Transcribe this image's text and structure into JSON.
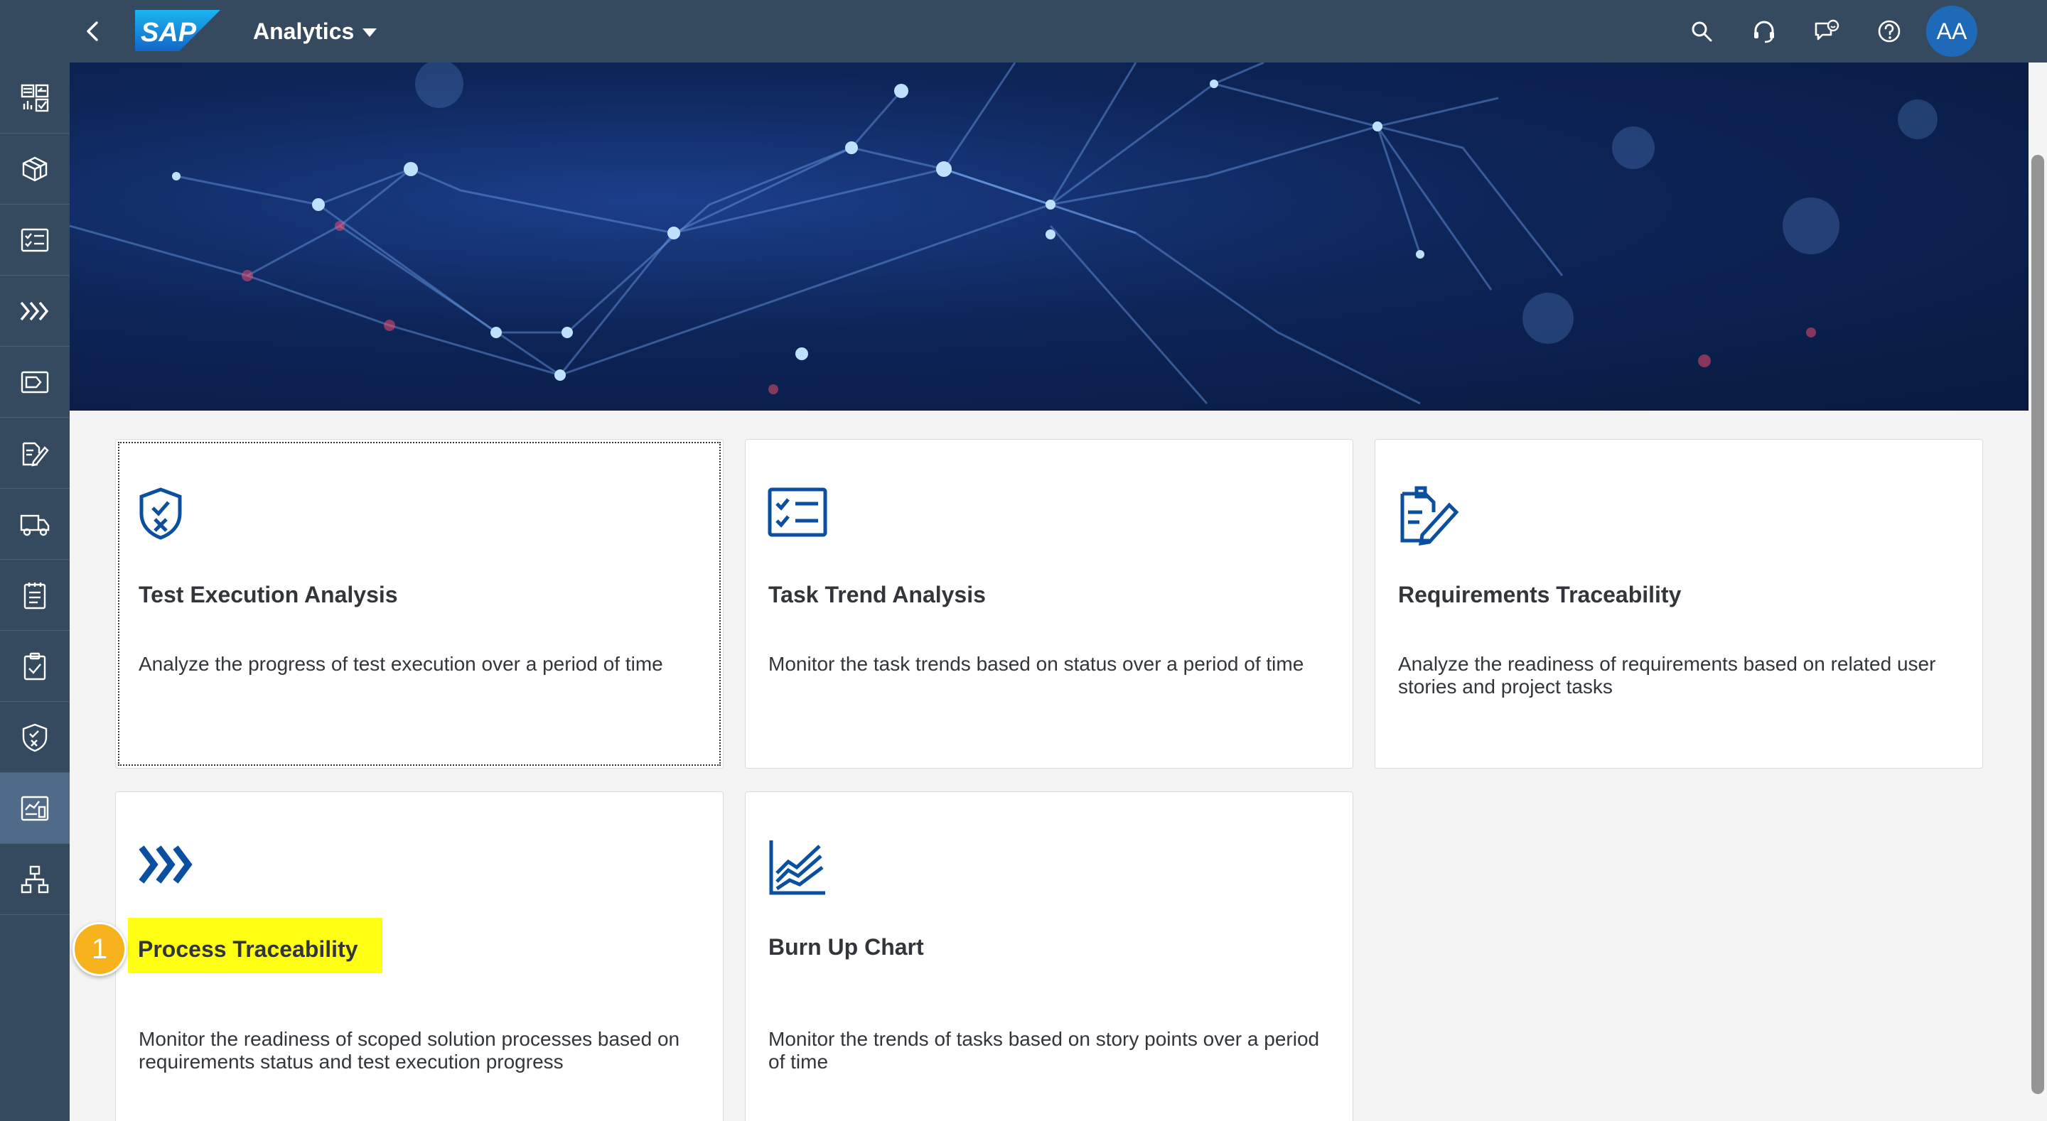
{
  "shell": {
    "app_title": "Analytics",
    "logo_text": "SAP",
    "avatar_initials": "AA",
    "icons": [
      "search-icon",
      "headset-icon",
      "feedback-icon",
      "help-icon"
    ]
  },
  "sidenav": {
    "items": [
      {
        "name": "dashboard-icon"
      },
      {
        "name": "solution-icon"
      },
      {
        "name": "checklist-icon"
      },
      {
        "name": "process-icon"
      },
      {
        "name": "tag-icon"
      },
      {
        "name": "edit-document-icon"
      },
      {
        "name": "delivery-truck-icon"
      },
      {
        "name": "notepad-icon"
      },
      {
        "name": "clipboard-check-icon"
      },
      {
        "name": "shield-check-icon"
      },
      {
        "name": "analytics-icon",
        "active": true
      },
      {
        "name": "hierarchy-icon"
      }
    ]
  },
  "tiles": [
    {
      "title": "Test Execution Analysis",
      "description": "Analyze the progress of test execution over a period of time",
      "icon": "shield-check-icon"
    },
    {
      "title": "Task Trend Analysis",
      "description": "Monitor the task trends based on status over a period of time",
      "icon": "checklist-icon"
    },
    {
      "title": "Requirements Traceability",
      "description": "Analyze the readiness of requirements based on related user stories and project tasks",
      "icon": "edit-document-icon"
    },
    {
      "title": "Process Traceability",
      "description": "Monitor the readiness of scoped solution processes based on requirements status and test execution progress",
      "icon": "process-icon"
    },
    {
      "title": "Burn Up Chart",
      "description": "Monitor the trends of tasks based on story points over a period of time",
      "icon": "line-chart-icon"
    }
  ],
  "callout": {
    "number": "1"
  },
  "colors": {
    "shell": "#354a5f",
    "accent": "#0a4fa0",
    "highlight": "#ffff14",
    "callout": "#f5b21d"
  }
}
